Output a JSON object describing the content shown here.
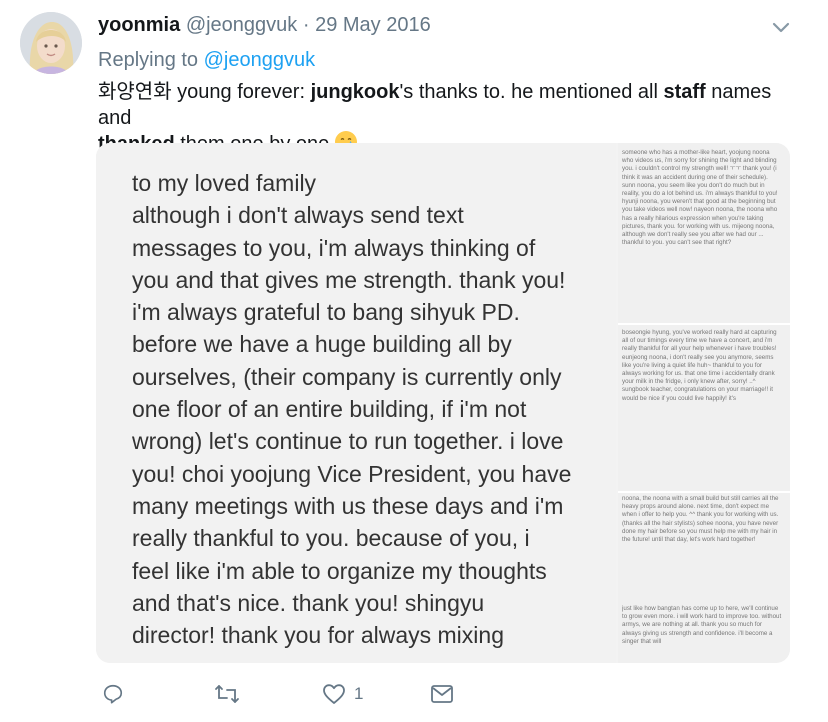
{
  "tweet": {
    "display_name": "yoonmia",
    "handle": "@jeonggvuk",
    "separator": "·",
    "date": "29 May 2016",
    "reply_prefix": "Replying to",
    "reply_to": "@jeonggvuk",
    "text_parts": [
      "화양연화 young forever: ",
      "jungkook",
      "'s thanks to. he mentioned all ",
      "staff",
      " names and ",
      "thanked",
      " them one by one"
    ],
    "emoji": "crying-face-emoji"
  },
  "image_text": {
    "lines": [
      "to my loved family",
      "although i don't always send text",
      "messages to you, i'm always thinking of",
      "you and that gives me strength. thank you!",
      "i'm always grateful to bang sihyuk PD.",
      "before we have a huge building all by",
      "ourselves, (their company is currently only",
      "one floor of an entire building, if i'm not",
      "wrong) let's continue to run together. i love",
      "you! choi yoojung Vice President, you have",
      "many meetings with us these days and i'm",
      "really thankful to you. because of you, i",
      "feel like i'm able to organize my thoughts",
      "and that's nice. thank you! shingyu",
      "director! thank you for always mixing"
    ],
    "side_segments": [
      "someone who has a mother-like heart, yoojung noona who videos us, i'm sorry for shining the light and blinding you. i couldn't control my strength well! ㅜㅜ thank you! (i think it was an accident during one of their schedule). sunn noona, you seem like you don't do much but in reality, you do a lot behind us. i'm always thankful to you! hyunji noona, you weren't that good at the beginning but you take videos well now! nayeon noona, the noona who has a really hilarious expression when you're taking pictures, thank you. for working with us. mijeong noona, although we don't really see you after we had our ... thankful to you. you can't see that right?",
      "boseongie hyung, you've worked really hard at capturing all of our timings every time we have a concert, and i'm really thankful for all your help whenever i have troubles! eunjeong noona, i don't really see you anymore, seems like you're living a quiet life huh~ thankful to you for always working for us. that one time i accidentally drank your milk in the fridge, i only knew after, sorry! ..^ sungbook teacher, congratulations on your marriage!! it would be nice if you could live happily! it's",
      "noona, the noona with a small build but still carries all the heavy props around alone. next time, don't expect me when i offer to help you. ^^ thank you for working with us. (thanks all the hair stylists) sohee noona, you have never done my hair before so you must help me with my hair in the future! until that day, let's work hard together!",
      "just like how bangtan has come up to here, we'll continue to grow even more. i will work hard to improve too. without armys, we are nothing at all. thank you so much for always giving us strength and confidence. i'll become a singer that will"
    ]
  },
  "actions": {
    "reply_icon": "reply-icon",
    "retweet_icon": "retweet-icon",
    "like_icon": "heart-icon",
    "like_count": "1",
    "dm_icon": "envelope-icon"
  },
  "colors": {
    "link": "#1da1f2",
    "meta": "#657786",
    "text": "#14171a"
  }
}
